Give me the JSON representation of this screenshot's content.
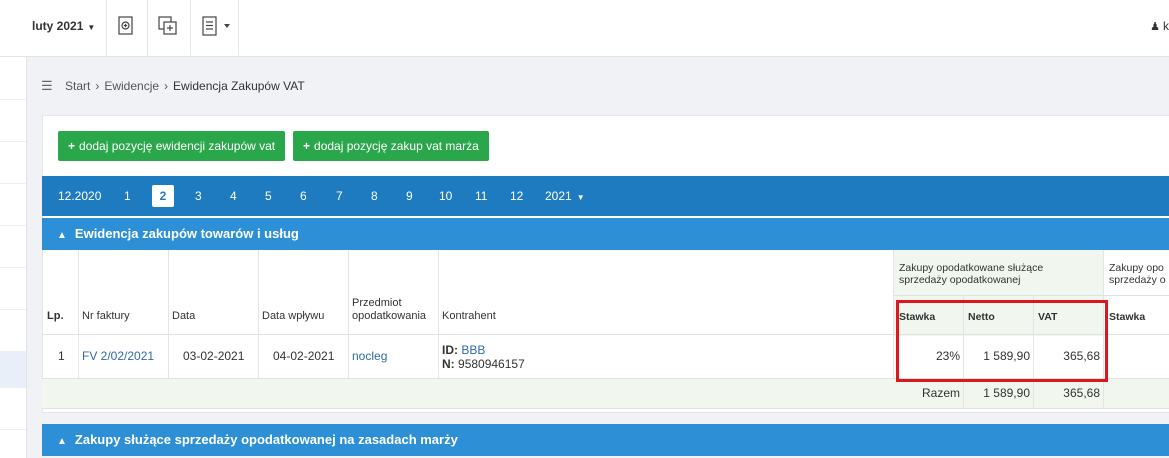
{
  "topbar": {
    "month_label": "luty 2021",
    "user_label": "k"
  },
  "breadcrumb": {
    "items": [
      "Start",
      "Ewidencje",
      "Ewidencja Zakupów VAT"
    ]
  },
  "actions": {
    "add_purchase_label": "dodaj pozycję ewidencji zakupów vat",
    "add_margin_label": "dodaj pozycję zakup vat marża"
  },
  "month_nav": {
    "items": [
      "12.2020",
      "1",
      "2",
      "3",
      "4",
      "5",
      "6",
      "7",
      "8",
      "9",
      "10",
      "11",
      "12",
      "2021"
    ],
    "active": "2"
  },
  "section1": {
    "title": "Ewidencja zakupów towarów i usług"
  },
  "table": {
    "headers": {
      "lp": "Lp.",
      "invoice": "Nr faktury",
      "date": "Data",
      "receipt_date": "Data wpływu",
      "subject": "Przedmiot opodatkowania",
      "contractor": "Kontrahent",
      "group1": "Zakupy opodatkowane służące sprzedaży opodatkowanej",
      "group2": "Zakupy opo sprzedaży o",
      "rate": "Stawka",
      "net": "Netto",
      "vat": "VAT",
      "rate2": "Stawka"
    },
    "row": {
      "lp": "1",
      "invoice": "FV 2/02/2021",
      "date": "03-02-2021",
      "receipt_date": "04-02-2021",
      "subject": "nocleg",
      "contractor_id_label": "ID:",
      "contractor_id": "BBB",
      "contractor_nip_label": "N:",
      "contractor_nip": "9580946157",
      "rate": "23%",
      "net": "1 589,90",
      "vat": "365,68"
    },
    "total": {
      "label": "Razem",
      "net": "1 589,90",
      "vat": "365,68"
    }
  },
  "section2": {
    "title": "Zakupy służące sprzedaży opodatkowanej na zasadach marży"
  },
  "colors": {
    "nav_blue": "#1f7bc0",
    "section_blue": "#2d8fd5",
    "button_green": "#2aa64b",
    "highlight_red": "#e0161f"
  }
}
